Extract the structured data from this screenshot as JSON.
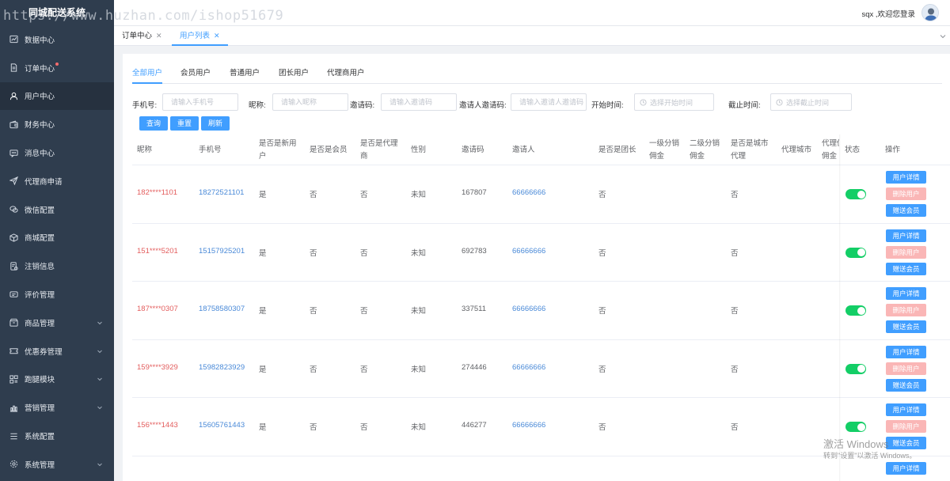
{
  "watermark": "https://www.huzhan.com/ishop51679",
  "app": {
    "title": "同城配送系统"
  },
  "sidebar": {
    "items": [
      {
        "label": "数据中心",
        "icon": "dashboard-icon"
      },
      {
        "label": "订单中心",
        "icon": "document-icon",
        "dot": true
      },
      {
        "label": "用户中心",
        "icon": "user-icon",
        "active": true
      },
      {
        "label": "财务中心",
        "icon": "wallet-icon"
      },
      {
        "label": "消息中心",
        "icon": "message-icon"
      },
      {
        "label": "代理商申请",
        "icon": "send-icon"
      },
      {
        "label": "微信配置",
        "icon": "wechat-icon"
      },
      {
        "label": "商城配置",
        "icon": "box-icon"
      },
      {
        "label": "注销信息",
        "icon": "cancel-doc-icon"
      },
      {
        "label": "评价管理",
        "icon": "comment-icon"
      },
      {
        "label": "商品管理",
        "icon": "goods-icon",
        "expandable": true
      },
      {
        "label": "优惠券管理",
        "icon": "coupon-icon",
        "expandable": true
      },
      {
        "label": "跑腿模块",
        "icon": "grid-icon",
        "expandable": true
      },
      {
        "label": "营销管理",
        "icon": "chart-icon",
        "expandable": true
      },
      {
        "label": "系统配置",
        "icon": "menu-icon"
      },
      {
        "label": "系统管理",
        "icon": "gear-icon",
        "expandable": true
      }
    ]
  },
  "header": {
    "welcome": "sqx ,欢迎您登录"
  },
  "tabs": [
    {
      "label": "订单中心",
      "active": false
    },
    {
      "label": "用户列表",
      "active": true
    }
  ],
  "user_tabs": [
    {
      "label": "全部用户",
      "active": true
    },
    {
      "label": "会员用户"
    },
    {
      "label": "普通用户"
    },
    {
      "label": "团长用户"
    },
    {
      "label": "代理商用户"
    }
  ],
  "filters": {
    "phone": {
      "label": "手机号:",
      "placeholder": "请输入手机号"
    },
    "nickname": {
      "label": "昵称:",
      "placeholder": "请输入昵称"
    },
    "invite_code": {
      "label": "邀请码:",
      "placeholder": "请输入邀请码"
    },
    "inviter_code": {
      "label": "邀请人邀请码:",
      "placeholder": "请输入邀请人邀请码"
    },
    "start_time": {
      "label": "开始时间:",
      "placeholder": "选择开始时间"
    },
    "end_time": {
      "label": "截止时间:",
      "placeholder": "选择截止时间"
    }
  },
  "buttons": {
    "search": "查询",
    "reset": "重置",
    "refresh": "刷新"
  },
  "columns": {
    "nickname": "昵称",
    "phone": "手机号",
    "is_new_1": "是否是新用",
    "is_new_2": "户",
    "is_member": "是否是会员",
    "is_agent_1": "是否是代理",
    "is_agent_2": "商",
    "gender": "性别",
    "invite_code": "邀请码",
    "inviter": "邀请人",
    "is_leader": "是否是团长",
    "commission1_1": "一级分销",
    "commission1_2": "佣金",
    "commission2_1": "二级分销",
    "commission2_2": "佣金",
    "city_agent_1": "是否是城市",
    "city_agent_2": "代理",
    "agent_city": "代理城市",
    "agent_comm_1": "代理佣",
    "agent_comm_2": "佣金",
    "status": "状态",
    "actions": "操作"
  },
  "actions": {
    "detail": "用户详情",
    "delete": "删除用户",
    "gift": "赠送会员"
  },
  "rows": [
    {
      "nickname": "182****1101",
      "phone": "18272521101",
      "is_new": "是",
      "is_member": "否",
      "is_agent": "否",
      "gender": "未知",
      "invite_code": "167807",
      "inviter": "66666666",
      "is_leader": "否",
      "is_city_agent": "否",
      "status": "on"
    },
    {
      "nickname": "151****5201",
      "phone": "15157925201",
      "is_new": "是",
      "is_member": "否",
      "is_agent": "否",
      "gender": "未知",
      "invite_code": "692783",
      "inviter": "66666666",
      "is_leader": "否",
      "is_city_agent": "否",
      "status": "on"
    },
    {
      "nickname": "187****0307",
      "phone": "18758580307",
      "is_new": "是",
      "is_member": "否",
      "is_agent": "否",
      "gender": "未知",
      "invite_code": "337511",
      "inviter": "66666666",
      "is_leader": "否",
      "is_city_agent": "否",
      "status": "on"
    },
    {
      "nickname": "159****3929",
      "phone": "15982823929",
      "is_new": "是",
      "is_member": "否",
      "is_agent": "否",
      "gender": "未知",
      "invite_code": "274446",
      "inviter": "66666666",
      "is_leader": "否",
      "is_city_agent": "否",
      "status": "on"
    },
    {
      "nickname": "156****1443",
      "phone": "15605761443",
      "is_new": "是",
      "is_member": "否",
      "is_agent": "否",
      "gender": "未知",
      "invite_code": "446277",
      "inviter": "66666666",
      "is_leader": "否",
      "is_city_agent": "否",
      "status": "on"
    }
  ],
  "activation": {
    "title": "激活 Windows",
    "subtitle": "转到\"设置\"以激活 Windows。"
  },
  "colors": {
    "sidebar": "#2f3d4e",
    "primary": "#409eff",
    "danger_light": "#fab6b6",
    "switch_on": "#13ce66",
    "nickname": "#e35d5d",
    "link": "#4a8ad8"
  }
}
